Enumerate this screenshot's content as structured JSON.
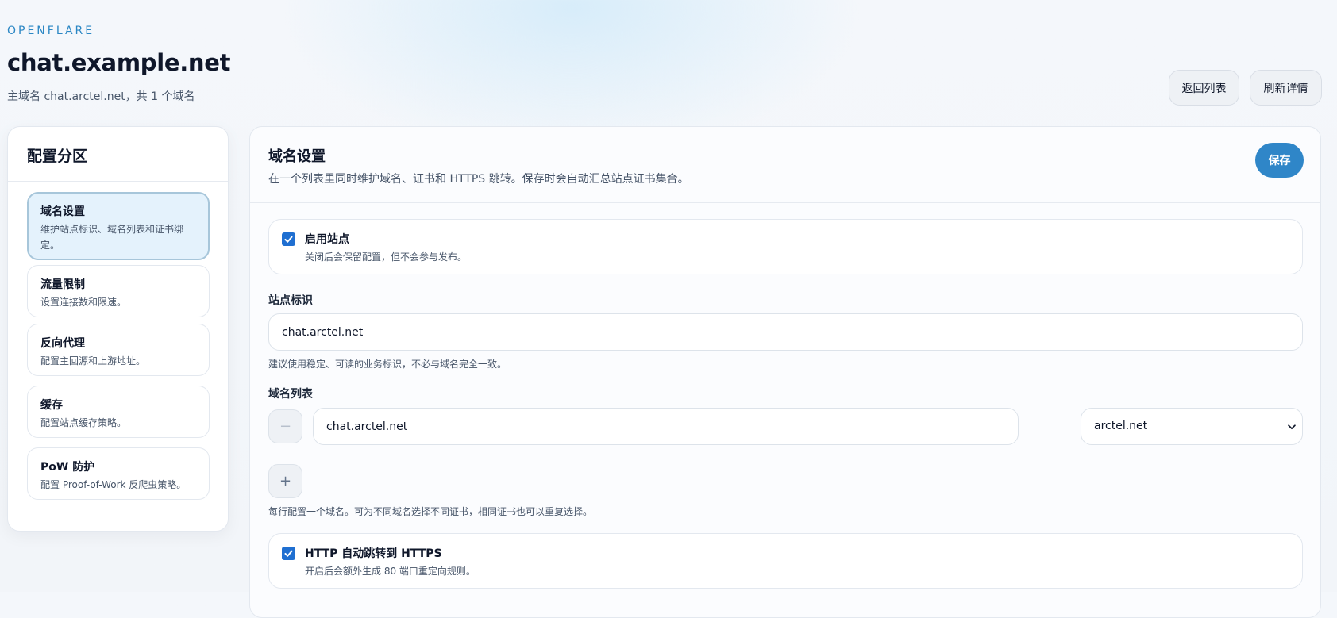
{
  "header": {
    "brand": "OPENFLARE",
    "title": "chat.example.net",
    "subtitle": "主域名 chat.arctel.net，共 1 个域名",
    "back_label": "返回列表",
    "refresh_label": "刷新详情"
  },
  "sidebar": {
    "title": "配置分区",
    "items": [
      {
        "label": "域名设置",
        "desc": "维护站点标识、域名列表和证书绑定。",
        "active": true
      },
      {
        "label": "流量限制",
        "desc": "设置连接数和限速。",
        "active": false
      },
      {
        "label": "反向代理",
        "desc": "配置主回源和上游地址。",
        "active": false
      },
      {
        "label": "缓存",
        "desc": "配置站点缓存策略。",
        "active": false
      },
      {
        "label": "PoW 防护",
        "desc": "配置 Proof-of-Work 反爬虫策略。",
        "active": false
      }
    ]
  },
  "main": {
    "title": "域名设置",
    "desc": "在一个列表里同时维护域名、证书和 HTTPS 跳转。保存时会自动汇总站点证书集合。",
    "save_label": "保存",
    "enable_site": {
      "label": "启用站点",
      "desc": "关闭后会保留配置，但不会参与发布。",
      "checked": true
    },
    "site_id": {
      "label": "站点标识",
      "value": "chat.arctel.net",
      "hint": "建议使用稳定、可读的业务标识，不必与域名完全一致。"
    },
    "domain_list": {
      "label": "域名列表",
      "rows": [
        {
          "domain": "chat.arctel.net",
          "certificate": "arctel.net"
        }
      ],
      "remove_symbol": "−",
      "add_symbol": "+",
      "hint": "每行配置一个域名。可为不同域名选择不同证书，相同证书也可以重复选择。"
    },
    "https_redirect": {
      "label": "HTTP 自动跳转到 HTTPS",
      "desc": "开启后会额外生成 80 端口重定向规则。",
      "checked": true
    }
  },
  "colors": {
    "accent": "#2f86c8",
    "brand": "#2b87c4",
    "checkbox": "#1f6fd1",
    "active_nav_bg": "#e4f2fc"
  },
  "icons": {
    "checkbox": "check-icon",
    "select": "chevron-down-icon",
    "remove": "minus-icon",
    "add": "plus-icon"
  }
}
